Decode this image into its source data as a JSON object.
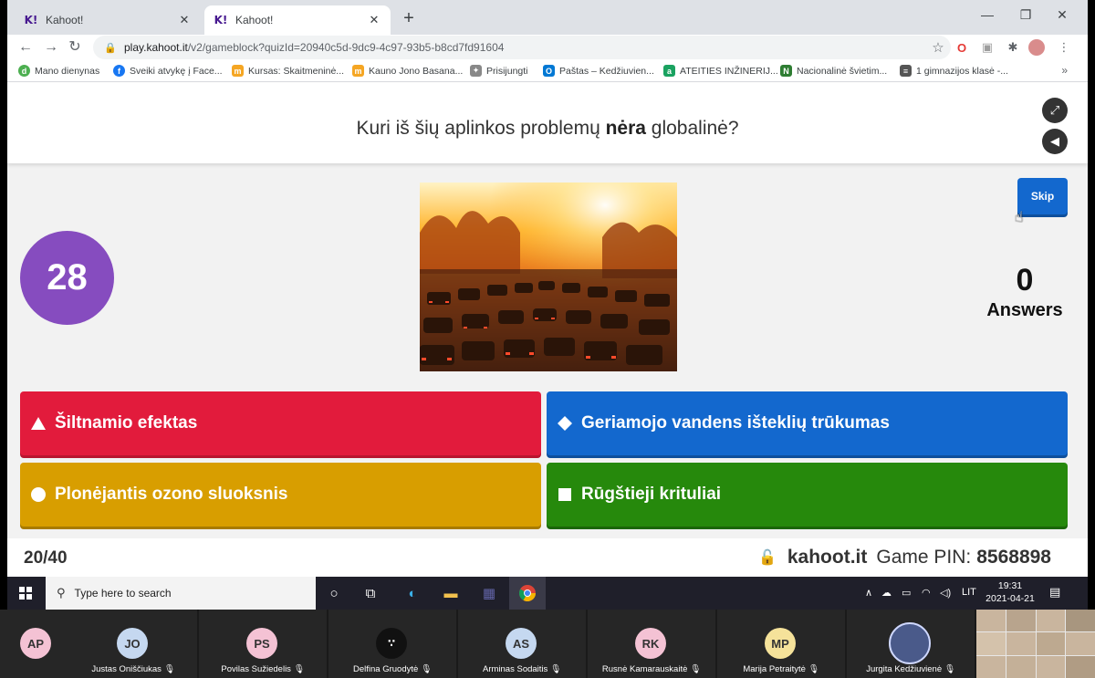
{
  "browser": {
    "tabs": [
      {
        "label": "Kahoot!",
        "favicon": "K!"
      },
      {
        "label": "Kahoot!",
        "favicon": "K!"
      }
    ],
    "url_host": "play.kahoot.it",
    "url_path": "/v2/gameblock?quizId=20940c5d-9dc9-4c97-93b5-b8cd7fd91604",
    "bookmarks": [
      {
        "label": "Mano dienynas",
        "color": "#4caf50",
        "glyph": "d"
      },
      {
        "label": "Sveiki atvykę į Face...",
        "color": "#1877f2",
        "glyph": "f"
      },
      {
        "label": "Kursas: Skaitmeninė...",
        "color": "#f5a623",
        "glyph": "m"
      },
      {
        "label": "Kauno Jono Basana...",
        "color": "#f5a623",
        "glyph": "m"
      },
      {
        "label": "Prisijungti",
        "color": "#888888",
        "glyph": "✦"
      },
      {
        "label": "Paštas – Kedžiuvien...",
        "color": "#0078d4",
        "glyph": "O"
      },
      {
        "label": "ATEITIES INŽINERIJ...",
        "color": "#1aa260",
        "glyph": "a"
      },
      {
        "label": "Nacionalinė švietim...",
        "color": "#2e7d32",
        "glyph": "N"
      },
      {
        "label": "1 gimnazijos klasė -...",
        "color": "#555555",
        "glyph": "≡"
      }
    ]
  },
  "quiz": {
    "question_before": "Kuri iš šių aplinkos problemų ",
    "question_bold": "nėra",
    "question_after": " globalinė?",
    "timer": "28",
    "skip_label": "Skip",
    "answers_count": "0",
    "answers_label": "Answers",
    "options": [
      {
        "text": "Šiltnamio efektas",
        "color": "red",
        "shape": "triangle"
      },
      {
        "text": "Geriamojo vandens išteklių trūkumas",
        "color": "blue",
        "shape": "diamond"
      },
      {
        "text": "Plonėjantis ozono sluoksnis",
        "color": "yellow",
        "shape": "circle"
      },
      {
        "text": "Rūgštieji krituliai",
        "color": "green",
        "shape": "square"
      }
    ],
    "progress": "20/40",
    "brand": "kahoot.it",
    "pin_label": "Game PIN:",
    "pin": "8568898"
  },
  "taskbar": {
    "search_placeholder": "Type here to search",
    "language": "LIT",
    "time": "19:31",
    "date": "2021-04-21"
  },
  "zoom": {
    "participants": [
      {
        "initials": "AP",
        "name": "",
        "color": "#f4c2d4"
      },
      {
        "initials": "JO",
        "name": "Justas Oniščiukas",
        "color": "#c5d8f0"
      },
      {
        "initials": "PS",
        "name": "Povilas Sužiedelis",
        "color": "#f4c2d4"
      },
      {
        "initials": "",
        "name": "Delfina Gruodytė",
        "color": "#111111"
      },
      {
        "initials": "AS",
        "name": "Arminas Sodaitis",
        "color": "#c5d8f0"
      },
      {
        "initials": "RK",
        "name": "Rusnė Kamarauskaitė",
        "color": "#f4c2d4"
      },
      {
        "initials": "MP",
        "name": "Marija Petraitytė",
        "color": "#f5e29a"
      },
      {
        "initials": "",
        "name": "Jurgita Kedžiuvienė",
        "color": "#4a5a8a"
      }
    ]
  }
}
